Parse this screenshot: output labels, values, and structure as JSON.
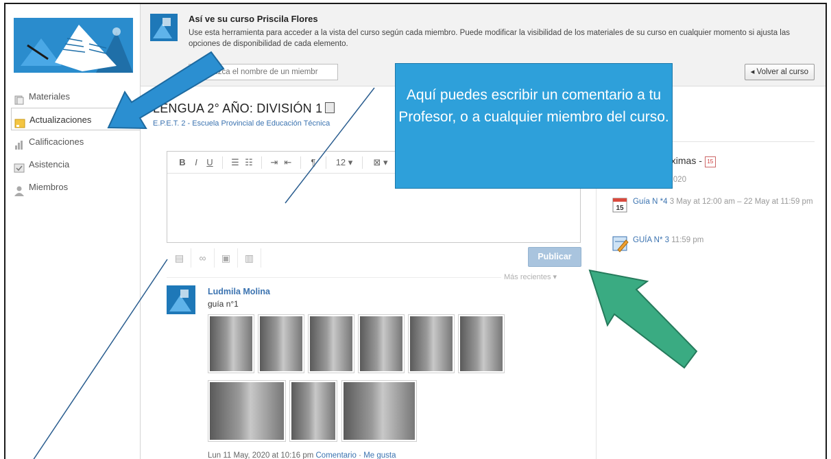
{
  "sidebar": {
    "items": [
      {
        "label": "Materiales",
        "icon": "materials-icon"
      },
      {
        "label": "Actualizaciones",
        "icon": "updates-icon",
        "active": true
      },
      {
        "label": "Calificaciones",
        "icon": "grades-icon"
      },
      {
        "label": "Asistencia",
        "icon": "attendance-icon"
      },
      {
        "label": "Miembros",
        "icon": "members-icon"
      }
    ]
  },
  "banner": {
    "title": "Así ve su curso Priscila Flores",
    "description": "Use esta herramienta para acceder a la vista del curso según cada miembro. Puede modificar la visibilidad de los materiales de su curso en cualquier momento si ajusta las opciones de disponibilidad de cada elemento.",
    "member_placeholder": "Introduzca el nombre de un miembr",
    "back_label": "◂ Volver al curso"
  },
  "course": {
    "title": "LENGUA 2° AÑO: DIVISIÓN 1",
    "school": "E.P.E.T. 2 - Escuela Provincial de Educación Técnica"
  },
  "editor": {
    "toolbar": [
      "B",
      "I",
      "U",
      "☰",
      "☷",
      "⇥",
      "⇤",
      "¶",
      "12 ▾",
      "⊠ ▾"
    ],
    "post_label": "Publicar"
  },
  "feed": {
    "sort_label": "Más recientes ▾",
    "post": {
      "author": "Ludmila Molina",
      "text": "guía n°1",
      "photo_count": 9,
      "timestamp": "Lun 11 May, 2020 at 10:16 pm",
      "comment_label": "Comentario",
      "separator": "·",
      "like_label": "Me gusta"
    }
  },
  "upcoming": {
    "title": "óximas -",
    "date_header": ", 2020",
    "calendar_badge": "15",
    "events": [
      {
        "name": "Guía N *4",
        "when": "3 May at 12:00 am – 22 May at 11:59 pm",
        "icon": "calendar-icon",
        "icon_day": "15"
      },
      {
        "name": "GUÍA N* 3",
        "when": "11:59 pm",
        "icon": "assignment-icon"
      }
    ]
  },
  "callout": {
    "text": "Aquí puedes escribir un comentario a tu Profesor, o a cualquier miembro del curso."
  },
  "colors": {
    "callout": "#2ea0da",
    "blue_arrow": "#2b8fd1",
    "green_arrow": "#3aab82",
    "link": "#3b73b0",
    "post_button": "#a9c4de"
  }
}
